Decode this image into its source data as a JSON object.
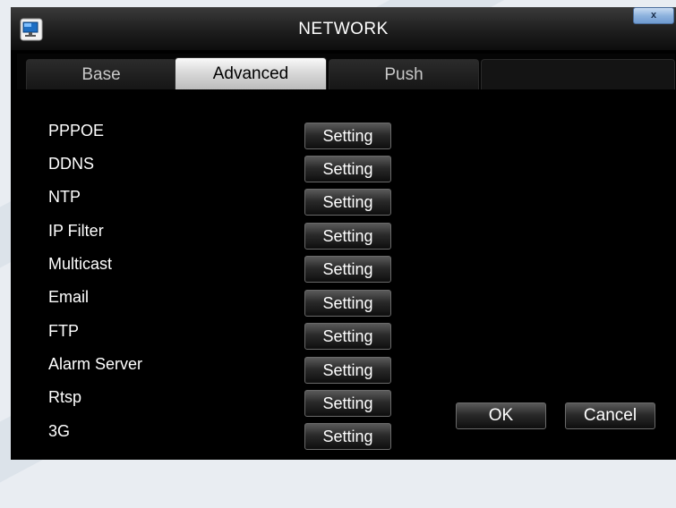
{
  "window": {
    "title": "NETWORK",
    "close_label": "x"
  },
  "tabs": [
    {
      "label": "Base",
      "active": false
    },
    {
      "label": "Advanced",
      "active": true
    },
    {
      "label": "Push",
      "active": false
    }
  ],
  "rows": [
    {
      "label": "PPPOE",
      "button": "Setting"
    },
    {
      "label": "DDNS",
      "button": "Setting"
    },
    {
      "label": "NTP",
      "button": "Setting"
    },
    {
      "label": "IP Filter",
      "button": "Setting"
    },
    {
      "label": "Multicast",
      "button": "Setting"
    },
    {
      "label": "Email",
      "button": "Setting"
    },
    {
      "label": "FTP",
      "button": "Setting"
    },
    {
      "label": "Alarm Server",
      "button": "Setting"
    },
    {
      "label": "Rtsp",
      "button": "Setting"
    },
    {
      "label": "3G",
      "button": "Setting"
    }
  ],
  "footer": {
    "ok_label": "OK",
    "cancel_label": "Cancel"
  },
  "colors": {
    "window_bg": "#000000",
    "text": "#ffffff",
    "close_button": "#8eb3de",
    "page_bg": "#e9edf2"
  },
  "icons": {
    "app": "monitor-icon",
    "close": "close-icon"
  }
}
